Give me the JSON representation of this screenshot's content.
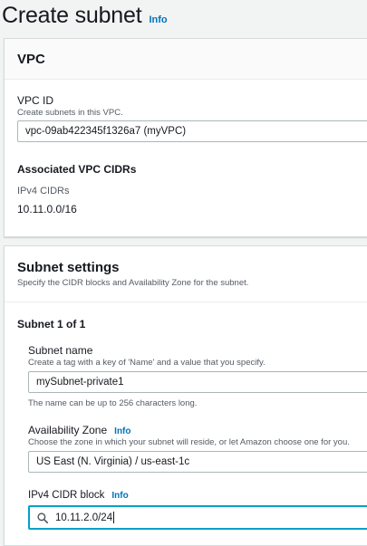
{
  "page": {
    "title": "Create subnet",
    "info": "Info"
  },
  "vpc_panel": {
    "title": "VPC",
    "vpc_id_label": "VPC ID",
    "vpc_id_desc": "Create subnets in this VPC.",
    "vpc_id_value": "vpc-09ab422345f1326a7 (myVPC)",
    "cidrs_heading": "Associated VPC CIDRs",
    "ipv4_cidrs_label": "IPv4 CIDRs",
    "ipv4_cidr_value": "10.11.0.0/16"
  },
  "subnet_panel": {
    "title": "Subnet settings",
    "desc": "Specify the CIDR blocks and Availability Zone for the subnet.",
    "subnet_heading": "Subnet 1 of 1",
    "name_label": "Subnet name",
    "name_desc": "Create a tag with a key of 'Name' and a value that you specify.",
    "name_value": "mySubnet-private1",
    "name_hint": "The name can be up to 256 characters long.",
    "az_label": "Availability Zone",
    "az_info": "Info",
    "az_desc": "Choose the zone in which your subnet will reside, or let Amazon choose one for you.",
    "az_value": "US East (N. Virginia) / us-east-1c",
    "cidr_label": "IPv4 CIDR block",
    "cidr_info": "Info",
    "cidr_value": "10.11.2.0/24"
  },
  "colors": {
    "link": "#0073bb",
    "focus": "#00a1c9",
    "border": "#aab7b8"
  },
  "icons": {
    "cidr_search": "search-icon"
  }
}
